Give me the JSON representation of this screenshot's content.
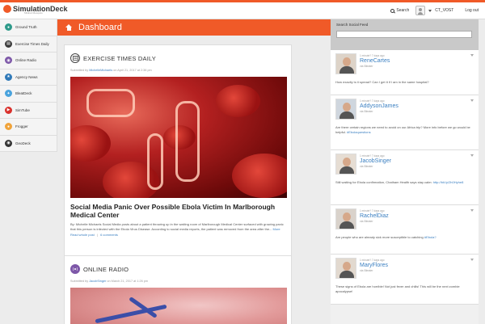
{
  "app": {
    "logo_text": "SimulationDeck",
    "logo_subtext": "Mildred Mesquito"
  },
  "topbar": {
    "search_label": "Search",
    "user_name": "CT_VOST",
    "logout_label": "Log out"
  },
  "sidebar": {
    "items": [
      {
        "label": "Ground Truth",
        "icon": "ground-truth-icon",
        "color": "#2e9a8a"
      },
      {
        "label": "Exercise Times Daily",
        "icon": "newspaper-icon",
        "color": "#3a3a3a"
      },
      {
        "label": "Online Radio",
        "icon": "radio-icon",
        "color": "#7d57a8"
      },
      {
        "label": "Agency News",
        "icon": "agency-icon",
        "color": "#2f79b8"
      },
      {
        "label": "BleatDeck",
        "icon": "bleat-icon",
        "color": "#49a3dd"
      },
      {
        "label": "SimTube",
        "icon": "play-icon",
        "color": "#d9302b"
      },
      {
        "label": "Frogger",
        "icon": "frog-icon",
        "color": "#f0a33a"
      },
      {
        "label": "GeoDeck",
        "icon": "map-pin-icon",
        "color": "#333333"
      }
    ]
  },
  "main": {
    "title": "Dashboard",
    "accent": "#f05a28",
    "card1": {
      "title": "EXERCISE TIMES DAILY",
      "meta_prefix": "Submitted by",
      "author": "MichelleMichaels",
      "meta_suffix": "on April 21, 2017 at 2:38 pm",
      "headline": "Social Media Panic Over Possible Ebola Victim In Marlborough Medical Center",
      "excerpt": "By: Michelle Michaels Social Media posts about a patient throwing up in the waiting room of Marlborough Medical Center surfaced with growing panic that this person is infected with the Ebola Virus Disease. According to social media reports, the patient was removed from the area after the...",
      "more": "More",
      "read_whole": "Read whole post",
      "comments": "6 comments"
    },
    "card2": {
      "title": "ONLINE RADIO",
      "meta_prefix": "Submitted by",
      "author": "JacobSinger",
      "meta_suffix": "on March 21, 2017 at 1:26 pm"
    }
  },
  "social": {
    "title": "Search Social Feed",
    "posts": [
      {
        "time": "1 minute? 7 days ago",
        "user": "ReneCartes",
        "via": "via Bleater",
        "text": "How exactly is it spread? Can I get it if I am in the same hospital?",
        "tag": ""
      },
      {
        "time": "1 minute? 7 days ago",
        "user": "AddysonJames",
        "via": "via Bleater",
        "text": "Are there certain regions we need to avoid on our Africa trip? More info before we go would be helpful.",
        "tag": "#Ebolaquestions"
      },
      {
        "time": "1 minute? 7 days ago",
        "user": "JacobSinger",
        "via": "via Bleater",
        "text": "Still waiting for Ebola confirmation, Chatham Health says stay calm:",
        "tag": "http://bit.ly/2h0Hyhe8"
      },
      {
        "time": "1 minute? 7 days ago",
        "user": "RachelDiaz",
        "via": "via Bleater",
        "text": "Are people who are already sick more susceptible to catching",
        "tag": "#Ebola?"
      },
      {
        "time": "1 minute? 7 days ago",
        "user": "MaryFlores",
        "via": "via Bleater",
        "text": "These signs of Ebola are horrible! Not just fever and chills! This will be the next zombie apocalypse!",
        "tag": ""
      }
    ]
  }
}
